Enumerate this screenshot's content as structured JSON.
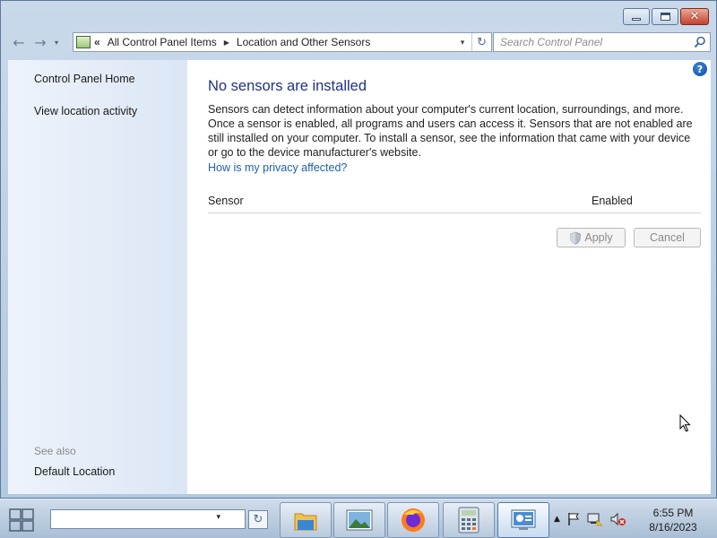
{
  "window": {
    "caption_buttons": [
      "minimize",
      "maximize",
      "close"
    ],
    "close_glyph": "✕"
  },
  "navbar": {
    "back_glyph": "←",
    "forward_glyph": "→",
    "history_glyph": "▾",
    "breadcrumb_overflow": "«",
    "breadcrumbs": [
      "All Control Panel Items",
      "Location and Other Sensors"
    ],
    "crumb_separator": "▶",
    "address_dropdown_glyph": "▾",
    "refresh_glyph": "↻",
    "search_placeholder": "Search Control Panel"
  },
  "left_pane": {
    "links": [
      "Control Panel Home",
      "View location activity"
    ],
    "see_also_label": "See also",
    "see_also_links": [
      "Default Location"
    ]
  },
  "main": {
    "help_glyph": "?",
    "title": "No sensors are installed",
    "description": "Sensors can detect information about your computer's current location, surroundings, and more. Once a sensor is enabled, all programs and users can access it. Sensors that are not enabled are still installed on your computer. To install a sensor, see the information that came with your device or go to the device manufacturer's website.",
    "privacy_link": "How is my privacy affected?",
    "columns": [
      "Sensor",
      "Enabled"
    ],
    "buttons": {
      "apply": "Apply",
      "cancel": "Cancel"
    }
  },
  "taskbar": {
    "address_dropdown_glyph": "▾",
    "refresh_glyph": "↻",
    "pinned": [
      "file-explorer",
      "photo-viewer",
      "firefox",
      "calculator",
      "control-panel"
    ],
    "tray_icons": [
      "show-hidden-icons",
      "action-center-flag",
      "network",
      "volume-muted"
    ],
    "clock_time": "6:55 PM",
    "clock_date": "8/16/2023"
  }
}
